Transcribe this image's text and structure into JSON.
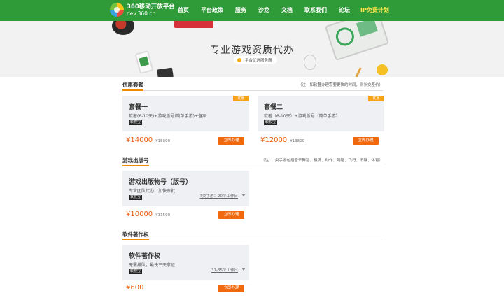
{
  "header": {
    "logo_title": "360移动开放平台",
    "logo_sub": "dev.360.cn",
    "nav": [
      "首页",
      "平台政策",
      "服务",
      "沙龙",
      "文档",
      "联系我们",
      "论坛"
    ],
    "nav_highlight": "IP免费计划"
  },
  "hero": {
    "title": "专业游戏资质代办",
    "badge": "平台优选服务商"
  },
  "sections": [
    {
      "title": "优惠套餐",
      "note": "（注：如软著办理需要更快的时间，则补交差价）",
      "cards": [
        {
          "name": "套餐一",
          "desc": "软著(6-10天)+游戏版号(简单手游)+备案",
          "tag": "软权宝",
          "ribbon": "优惠",
          "price": "¥14000",
          "old_price": "¥15800",
          "action": "立即办理"
        },
        {
          "name": "套餐二",
          "desc": "软著（6-10天）+游戏版号（简单手游）",
          "tag": "软权宝",
          "ribbon": "优惠",
          "price": "¥12000",
          "old_price": "¥13800",
          "action": "立即办理"
        }
      ]
    },
    {
      "title": "游戏出版号",
      "note": "（注：7类手游包括音乐舞蹈、棋牌、动作、跑酷、飞行、消除、体育）",
      "cards": [
        {
          "name": "游戏出版物号（版号）",
          "desc": "专业团队代办，加快审批",
          "tag": "软权宝",
          "time": "7类手游：20个工作日",
          "price": "¥10000",
          "old_price": "¥11500",
          "action": "立即办理"
        }
      ]
    },
    {
      "title": "软件著作权",
      "note": "",
      "cards": [
        {
          "name": "软件著作权",
          "desc": "无需排队，最快三天拿证",
          "tag": "软权宝",
          "time": "31-35个工作日",
          "price": "¥600",
          "old_price": "",
          "action": "立即办理"
        }
      ]
    }
  ],
  "colors": {
    "nav_green": "#2f9a38",
    "accent_orange": "#f0690f",
    "price_orange": "#e8590c",
    "ribbon": "#f5a318"
  }
}
